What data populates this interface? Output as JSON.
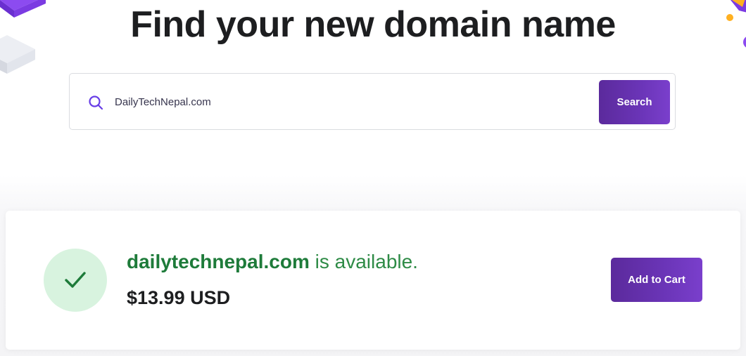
{
  "header": {
    "title": "Find your new domain name"
  },
  "search": {
    "icon": "search-icon",
    "value": "DailyTechNepal.com",
    "button_label": "Search"
  },
  "result": {
    "domain": "dailytechnepal.com",
    "availability_suffix": " is available.",
    "price": "$13.99 USD",
    "status_icon": "checkmark-icon",
    "add_to_cart_label": "Add to Cart"
  },
  "colors": {
    "accent_purple": "#673de6",
    "button_purple": "#5b2a9c",
    "success_green": "#1e7b3a",
    "success_bg": "#d8f3df",
    "title_dark": "#1d1e20"
  }
}
